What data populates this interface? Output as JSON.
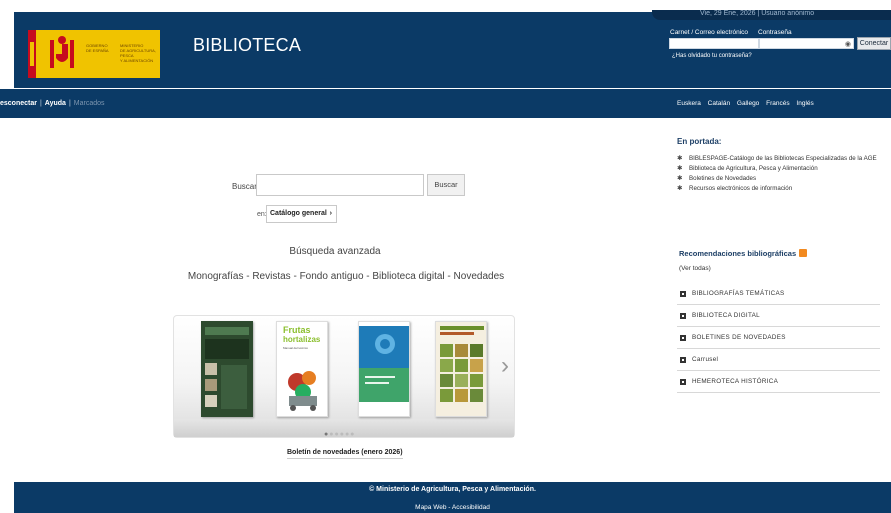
{
  "header": {
    "gov_line1": "GOBIERNO",
    "gov_line2": "DE ESPAÑA",
    "ministry_line1": "MINISTERIO",
    "ministry_line2": "DE AGRICULTURA, PESCA",
    "ministry_line3": "Y ALIMENTACIÓN",
    "site_title": "BIBLIOTECA",
    "status_text": "Vie, 29 Ene, 2026  |  Usuario anónimo",
    "card_label": "Carnet / Correo electrónico",
    "password_label": "Contraseña",
    "connect_label": "Conectar",
    "forgot_label": "¿Has olvidado tu contraseña?"
  },
  "nav": {
    "disconnect": "esconectar",
    "help": "Ayuda",
    "bookmarks": "Marcados",
    "languages": [
      "Euskera",
      "Catalán",
      "Gallego",
      "Francés",
      "Inglés"
    ]
  },
  "search": {
    "label": "Buscar:",
    "input_value": "",
    "button": "Buscar",
    "in_label": "en:",
    "catalog": "Catálogo general",
    "advanced": "Búsqueda avanzada",
    "quick_links": "Monografías - Revistas - Fondo antiguo - Biblioteca digital - Novedades"
  },
  "carousel": {
    "book2_title_line1": "Frutas",
    "book2_title_line2": "hortalizas",
    "book2_subtitle": "Manual del técnico",
    "dots": 6,
    "active_dot": 1,
    "boletin_link": "Boletín de novedades (enero 2026)"
  },
  "sidebar": {
    "portada_title": "En portada:",
    "portada_items": [
      "BIBLESPAGE-Catálogo de las Bibliotecas Especializadas de la AGE",
      "Biblioteca de Agricultura, Pesca y Alimentación",
      "Boletines de Novedades",
      "Recursos electrónicos de información"
    ],
    "rec_title": "Recomendaciones bibliográficas",
    "rec_all": "(Ver todas)",
    "rec_items": [
      "BIBLIOGRAFÍAS TEMÁTICAS",
      "BIBLIOTECA DIGITAL",
      "BOLETINES DE NOVEDADES",
      "Carrusel",
      "HEMEROTECA HISTÓRICA"
    ]
  },
  "footer": {
    "copyright": "© Ministerio de Agricultura, Pesca y Alimentación.",
    "links": "Mapa Web - Accesibilidad"
  },
  "colors": {
    "brand_blue": "#0b3a66",
    "gov_yellow": "#f0c300",
    "spain_red": "#c60b1e",
    "rss_orange": "#f28a20"
  }
}
